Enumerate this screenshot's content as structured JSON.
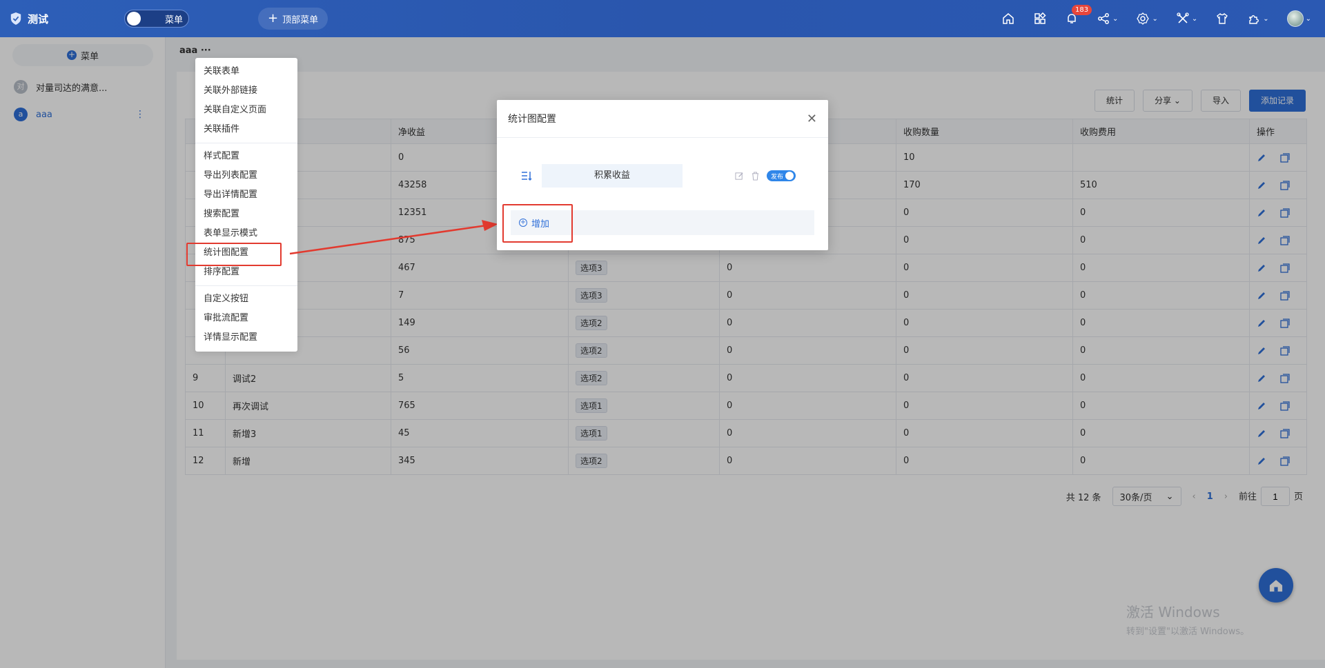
{
  "topbar": {
    "app_title": "测试",
    "menu_toggle_label": "菜单",
    "top_menu_label": "顶部菜单",
    "notification_count": "183"
  },
  "sidebar": {
    "menu_button": "菜单",
    "items": [
      {
        "avatar": "对",
        "label": "对量司达的满意...",
        "avatar_color": "#b9bfc9"
      },
      {
        "avatar": "a",
        "label": "aaa",
        "avatar_color": "#2f6fd8"
      }
    ]
  },
  "breadcrumb": "aaa",
  "toolbar": {
    "stats": "统计",
    "share": "分享",
    "import": "导入",
    "add_record": "添加记录"
  },
  "table": {
    "headers": [
      "",
      "",
      "净收益",
      "",
      "",
      "收购数量",
      "收购费用",
      "操作"
    ],
    "rows": [
      {
        "no": "",
        "name": "",
        "net": "0",
        "option": "",
        "c5": "",
        "qty": "10",
        "fee": ""
      },
      {
        "no": "",
        "name": "",
        "net": "43258",
        "option": "",
        "c5": "",
        "qty": "170",
        "fee": "510"
      },
      {
        "no": "",
        "name": "",
        "net": "12351",
        "option": "",
        "c5": "",
        "qty": "0",
        "fee": "0"
      },
      {
        "no": "",
        "name": "",
        "net": "875",
        "option": "",
        "c5": "",
        "qty": "0",
        "fee": "0"
      },
      {
        "no": "",
        "name": "",
        "net": "467",
        "option": "选项3",
        "c5": "0",
        "qty": "0",
        "fee": "0"
      },
      {
        "no": "",
        "name": "",
        "net": "7",
        "option": "选项3",
        "c5": "0",
        "qty": "0",
        "fee": "0"
      },
      {
        "no": "",
        "name": "",
        "net": "149",
        "option": "选项2",
        "c5": "0",
        "qty": "0",
        "fee": "0"
      },
      {
        "no": "",
        "name": "",
        "net": "56",
        "option": "选项2",
        "c5": "0",
        "qty": "0",
        "fee": "0"
      },
      {
        "no": "9",
        "name": "调试2",
        "net": "5",
        "option": "选项2",
        "c5": "0",
        "qty": "0",
        "fee": "0"
      },
      {
        "no": "10",
        "name": "再次调试",
        "net": "765",
        "option": "选项1",
        "c5": "0",
        "qty": "0",
        "fee": "0"
      },
      {
        "no": "11",
        "name": "新增3",
        "net": "45",
        "option": "选项1",
        "c5": "0",
        "qty": "0",
        "fee": "0"
      },
      {
        "no": "12",
        "name": "新增",
        "net": "345",
        "option": "选项2",
        "c5": "0",
        "qty": "0",
        "fee": "0"
      }
    ]
  },
  "pagination": {
    "total": "共 12 条",
    "page_size": "30条/页",
    "current_page": "1",
    "goto_label": "前往",
    "goto_value": "1",
    "page_suffix": "页"
  },
  "dropdown": {
    "groups": [
      [
        "关联表单",
        "关联外部链接",
        "关联自定义页面",
        "关联插件"
      ],
      [
        "样式配置",
        "导出列表配置",
        "导出详情配置",
        "搜索配置",
        "表单显示模式",
        "统计图配置",
        "排序配置"
      ],
      [
        "自定义按钮",
        "审批流配置",
        "详情显示配置"
      ]
    ]
  },
  "modal": {
    "title": "统计图配置",
    "config_item": "积累收益",
    "switch_label": "发布",
    "add_label": "增加"
  },
  "watermark": {
    "line1": "激活 Windows",
    "line2": "转到\"设置\"以激活 Windows。"
  },
  "colors": {
    "accent": "#2f6fd8",
    "highlight": "#e23a2f"
  }
}
